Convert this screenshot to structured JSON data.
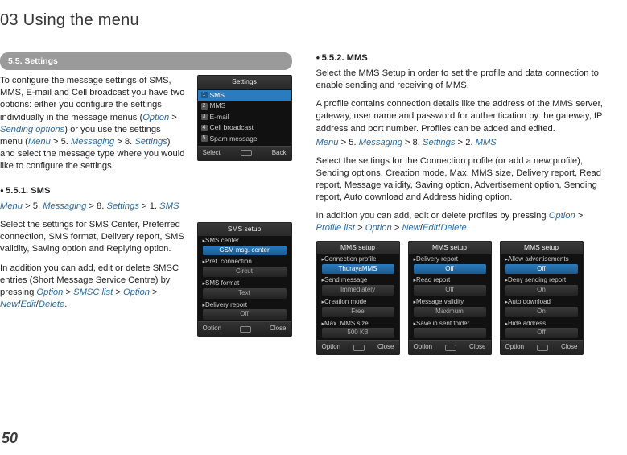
{
  "page_title": "03 Using the menu",
  "page_number": "50",
  "left": {
    "section_bar": "5.5. Settings",
    "intro_parts": {
      "a": "To configure the message settings of SMS, MMS, E-mail and Cell broadcast you have two options: either you configure the settings individually in the message menus (",
      "b": "Option",
      "c": " > ",
      "d": "Sending options",
      "e": ") or you use the settings menu (",
      "f": "Menu",
      "g": " > 5. ",
      "h": "Messaging",
      "i": " > 8. ",
      "j": "Settings",
      "k": ") and select the message type where you would like to configure the settings."
    },
    "screen1": {
      "title": "Settings",
      "items": [
        "SMS",
        "MMS",
        "E-mail",
        "Cell broadcast",
        "Spam message"
      ],
      "soft_left": "Select",
      "soft_right": "Back"
    },
    "sms": {
      "heading": "5.5.1. SMS",
      "path": {
        "a": "Menu",
        "b": " > 5. ",
        "c": "Messaging",
        "d": " > 8. ",
        "e": "Settings",
        "f": " > 1. ",
        "g": "SMS"
      },
      "p1": "Select the settings for SMS Center, Preferred connection, SMS format, Delivery report, SMS validity, Saving option and Replying option.",
      "p2_parts": {
        "a": "In addition you can add, edit or delete SMSC entries (Short Message Service Centre) by pressing ",
        "b": "Option",
        "c": " > ",
        "d": "SMSC list",
        "e": " > ",
        "f": "Option",
        "g": " > ",
        "h": "New",
        "i": "/",
        "j": "Edit",
        "k": "/",
        "l": "Delete",
        "m": "."
      },
      "screen": {
        "title": "SMS setup",
        "rows": [
          {
            "label": "SMS center",
            "value": "GSM msg. center",
            "sel": true
          },
          {
            "label": "Pref. connection",
            "value": "Circut",
            "sel": false
          },
          {
            "label": "SMS format",
            "value": "Text",
            "sel": false
          },
          {
            "label": "Delivery report",
            "value": "Off",
            "sel": false
          }
        ],
        "soft_left": "Option",
        "soft_right": "Close"
      }
    }
  },
  "right": {
    "mms": {
      "heading": "5.5.2. MMS",
      "p1": "Select the MMS Setup in order to set the profile and data connection to enable sending and receiving of MMS.",
      "p2": "A profile contains connection details like the address of the MMS server, gateway, user name and password for authentication by the gateway, IP address and port number. Profiles can be added and edited.",
      "path": {
        "a": "Menu",
        "b": " > 5. ",
        "c": "Messaging",
        "d": " > 8. ",
        "e": "Settings",
        "f": " > 2. ",
        "g": "MMS"
      },
      "p3": "Select the settings for the Connection profile (or add a new profile), Sending options, Creation mode, Max. MMS size, Delivery report, Read report, Message validity, Saving option, Advertisement option, Sending report, Auto download and Address hiding option.",
      "p4_parts": {
        "a": "In addition you can add, edit or delete profiles by pressing ",
        "b": "Option",
        "c": " > ",
        "d": "Profile list",
        "e": " > ",
        "f": "Option",
        "g": " > ",
        "h": "New",
        "i": "/",
        "j": "Edit",
        "k": "/",
        "l": "Delete",
        "m": "."
      },
      "screens": [
        {
          "title": "MMS setup",
          "rows": [
            {
              "label": "Connection profile",
              "value": "ThurayaMMS",
              "sel": true
            },
            {
              "label": "Send message",
              "value": "Immediately",
              "sel": false
            },
            {
              "label": "Creation mode",
              "value": "Free",
              "sel": false
            },
            {
              "label": "Max. MMS size",
              "value": "500 KB",
              "sel": false
            }
          ],
          "soft_left": "Option",
          "soft_right": "Close"
        },
        {
          "title": "MMS setup",
          "rows": [
            {
              "label": "Delivery report",
              "value": "Off",
              "sel": true
            },
            {
              "label": "Read report",
              "value": "Off",
              "sel": false
            },
            {
              "label": "Message validity",
              "value": "Maximum",
              "sel": false
            },
            {
              "label": "Save in sent folder",
              "value": "",
              "sel": false
            }
          ],
          "soft_left": "Option",
          "soft_right": "Close"
        },
        {
          "title": "MMS setup",
          "rows": [
            {
              "label": "Allow advertisements",
              "value": "Off",
              "sel": true
            },
            {
              "label": "Deny sending report",
              "value": "On",
              "sel": false
            },
            {
              "label": "Auto download",
              "value": "On",
              "sel": false
            },
            {
              "label": "Hide address",
              "value": "Off",
              "sel": false
            }
          ],
          "soft_left": "Option",
          "soft_right": "Close"
        }
      ]
    }
  }
}
